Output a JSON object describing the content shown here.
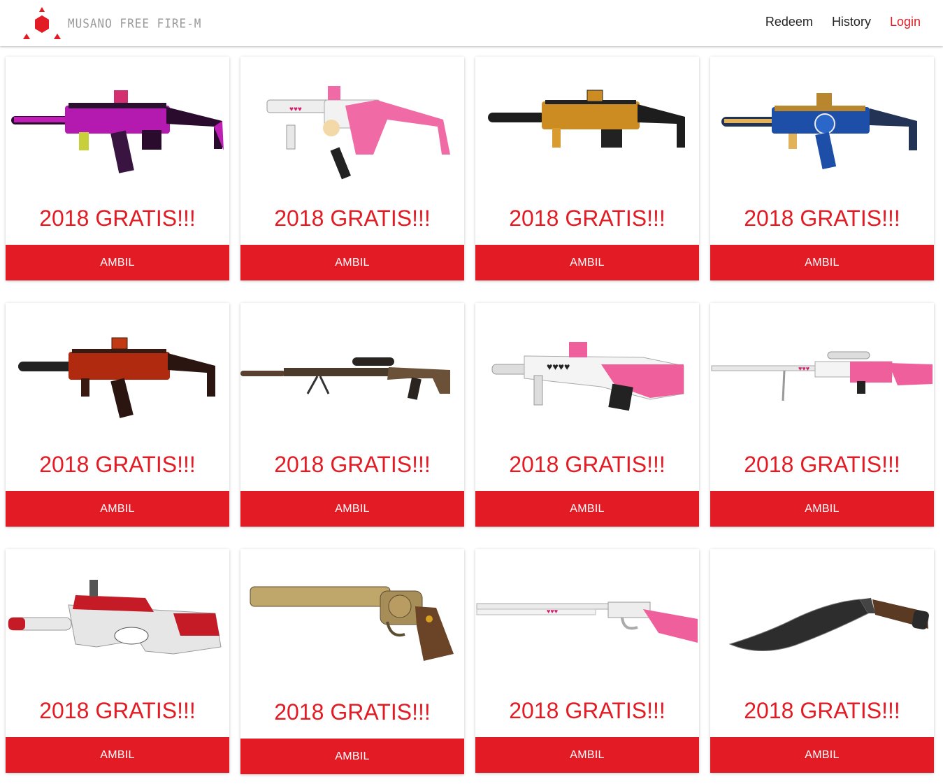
{
  "brand": {
    "name": "MUSANO FREE FIRE-M",
    "accent": "#e21b24"
  },
  "nav": {
    "redeem": "Redeem",
    "history": "History",
    "login": "Login"
  },
  "cards": [
    {
      "title": "2018 GRATIS!!!",
      "button": "AMBIL",
      "weapon": "smg-purple-icon"
    },
    {
      "title": "2018 GRATIS!!!",
      "button": "AMBIL",
      "weapon": "smg-pink-icon"
    },
    {
      "title": "2018 GRATIS!!!",
      "button": "AMBIL",
      "weapon": "smg-gold-icon"
    },
    {
      "title": "2018 GRATIS!!!",
      "button": "AMBIL",
      "weapon": "smg-blue-icon"
    },
    {
      "title": "2018 GRATIS!!!",
      "button": "AMBIL",
      "weapon": "smg-red-icon"
    },
    {
      "title": "2018 GRATIS!!!",
      "button": "AMBIL",
      "weapon": "sniper-brown-icon"
    },
    {
      "title": "2018 GRATIS!!!",
      "button": "AMBIL",
      "weapon": "rifle-pink-icon"
    },
    {
      "title": "2018 GRATIS!!!",
      "button": "AMBIL",
      "weapon": "sniper-pink-icon"
    },
    {
      "title": "2018 GRATIS!!!",
      "button": "AMBIL",
      "weapon": "p90-red-icon"
    },
    {
      "title": "2018 GRATIS!!!",
      "button": "AMBIL",
      "weapon": "revolver-gold-icon"
    },
    {
      "title": "2018 GRATIS!!!",
      "button": "AMBIL",
      "weapon": "shotgun-pink-icon"
    },
    {
      "title": "2018 GRATIS!!!",
      "button": "AMBIL",
      "weapon": "kukri-knife-icon"
    }
  ]
}
